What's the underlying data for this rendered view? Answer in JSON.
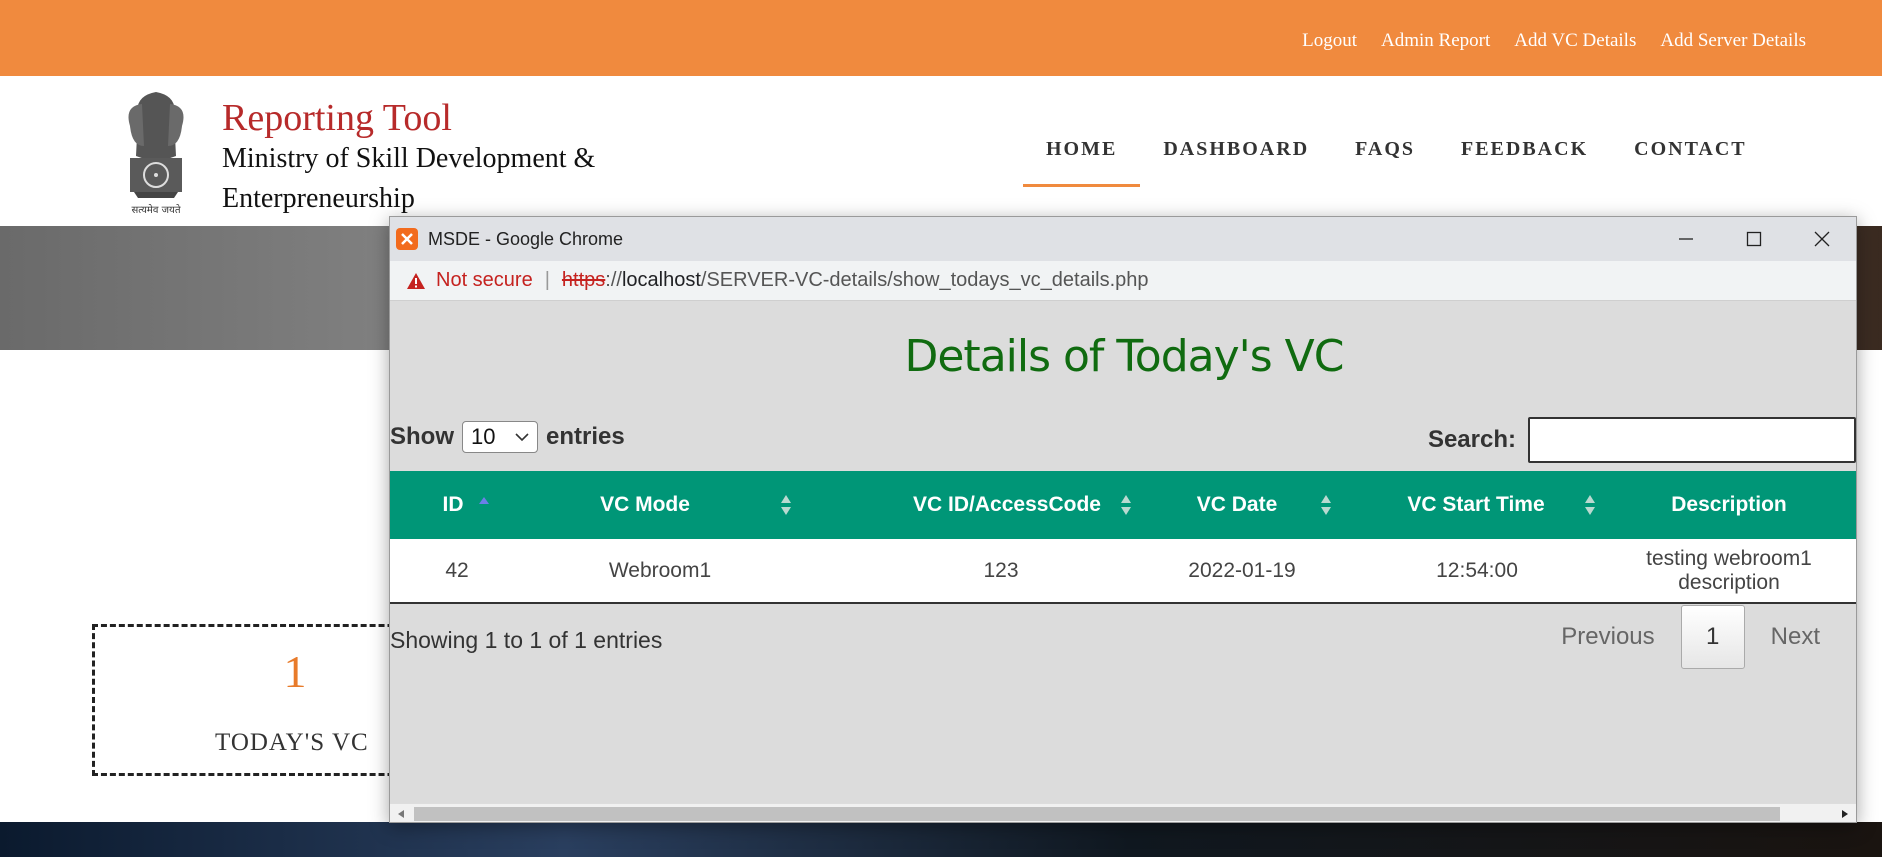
{
  "topbar": {
    "links": [
      "Logout",
      "Admin Report",
      "Add VC Details",
      "Add Server Details"
    ]
  },
  "brand": {
    "title": "Reporting Tool",
    "subtitle_line1": "Ministry of Skill Development &",
    "subtitle_line2": "Enterpreneurship",
    "emblem_caption": "सत्यमेव जयते"
  },
  "nav": {
    "items": [
      "HOME",
      "DASHBOARD",
      "FAQS",
      "FEEDBACK",
      "CONTACT"
    ],
    "active": "HOME"
  },
  "vc_card": {
    "count": "1",
    "label": "TODAY'S VC"
  },
  "popup": {
    "window_title": "MSDE - Google Chrome",
    "address": {
      "security_label": "Not secure",
      "scheme": "https",
      "scheme_sep": "://",
      "host": "localhost",
      "path": "/SERVER-VC-details/show_todays_vc_details.php"
    },
    "heading": "Details of Today's VC",
    "length": {
      "show_label": "Show",
      "value": "10",
      "entries_label": "entries"
    },
    "search": {
      "label": "Search:",
      "value": ""
    },
    "table": {
      "columns": [
        "ID",
        "VC Mode",
        "VC ID/AccessCode",
        "VC Date",
        "VC Start Time",
        "Description"
      ],
      "rows": [
        [
          "42",
          "Webroom1",
          "123",
          "2022-01-19",
          "12:54:00",
          "testing webroom1 description"
        ]
      ]
    },
    "info": "Showing 1 to 1 of 1 entries",
    "pager": {
      "previous": "Previous",
      "current": "1",
      "next": "Next"
    }
  },
  "colors": {
    "topbar": "#f08a3e",
    "brand_title": "#b72a2a",
    "heading": "#106b10",
    "table_header": "#009677",
    "not_secure": "#c5221f"
  }
}
